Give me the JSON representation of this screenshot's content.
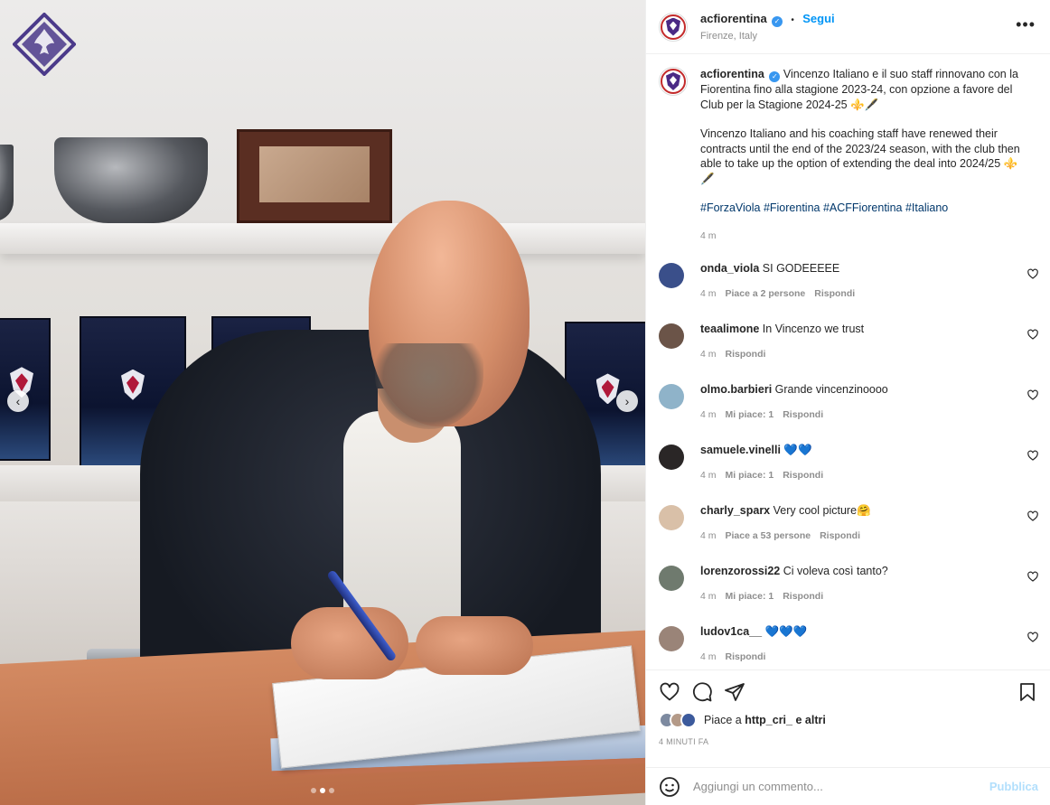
{
  "post": {
    "username": "acfiorentina",
    "verified_glyph": "✓",
    "follow_separator": "•",
    "follow_label": "Segui",
    "location": "Firenze, Italy",
    "more_glyph": "•••",
    "carousel": {
      "slide_count": 3,
      "active_slide": 2,
      "prev_glyph": "‹",
      "next_glyph": "›"
    }
  },
  "caption": {
    "username": "acfiorentina",
    "para_it": "Vincenzo Italiano e il suo staff rinnovano con la Fiorentina fino alla stagione 2023-24, con opzione a favore del Club per la Stagione 2024-25 ⚜️🖋️",
    "para_en": "Vincenzo Italiano and his coaching staff have renewed their contracts until the end of the 2023/24 season, with the club then able to take up the option of extending the deal into 2024/25 ⚜️🖋️",
    "hashtags": "#ForzaViola #Fiorentina #ACFFiorentina #Italiano",
    "time": "4 m"
  },
  "comments": [
    {
      "user": "onda_viola",
      "text": "SI GODEEEEE",
      "time": "4 m",
      "likes": "Piace a 2 persone",
      "reply": "Rispondi",
      "avatar_color": "#3a4f8a"
    },
    {
      "user": "teaalimone",
      "text": "In Vincenzo we trust",
      "time": "4 m",
      "likes": "",
      "reply": "Rispondi",
      "avatar_color": "#6b5448"
    },
    {
      "user": "olmo.barbieri",
      "text": "Grande vincenzinoooo",
      "time": "4 m",
      "likes": "Mi piace: 1",
      "reply": "Rispondi",
      "avatar_color": "#8fb3c9"
    },
    {
      "user": "samuele.vinelli",
      "text": "💙💙",
      "time": "4 m",
      "likes": "Mi piace: 1",
      "reply": "Rispondi",
      "avatar_color": "#2a2626"
    },
    {
      "user": "charly_sparx",
      "text": "Very cool picture🤗",
      "time": "4 m",
      "likes": "Piace a 53 persone",
      "reply": "Rispondi",
      "avatar_color": "#d9c0a8"
    },
    {
      "user": "lorenzorossi22",
      "text": "Ci voleva così tanto?",
      "time": "4 m",
      "likes": "Mi piace: 1",
      "reply": "Rispondi",
      "avatar_color": "#6f7a6e"
    },
    {
      "user": "ludov1ca__",
      "text": "💙💙💙",
      "time": "4 m",
      "likes": "",
      "reply": "Rispondi",
      "avatar_color": "#9a8478"
    }
  ],
  "actions": {
    "liked_by_prefix": "Piace a",
    "liked_by_user": "http_cri_",
    "liked_by_suffix": "e altri",
    "posted_time": "4 MINUTI FA",
    "stack_colors": [
      "#7d8aa0",
      "#b49a88",
      "#3c5a9c"
    ]
  },
  "comment_box": {
    "placeholder": "Aggiungi un commento...",
    "publish_label": "Pubblica"
  },
  "colors": {
    "link": "#0095f6",
    "hashtag": "#00376b",
    "club_purple": "#4b2a85",
    "club_red": "#c32a2a"
  }
}
